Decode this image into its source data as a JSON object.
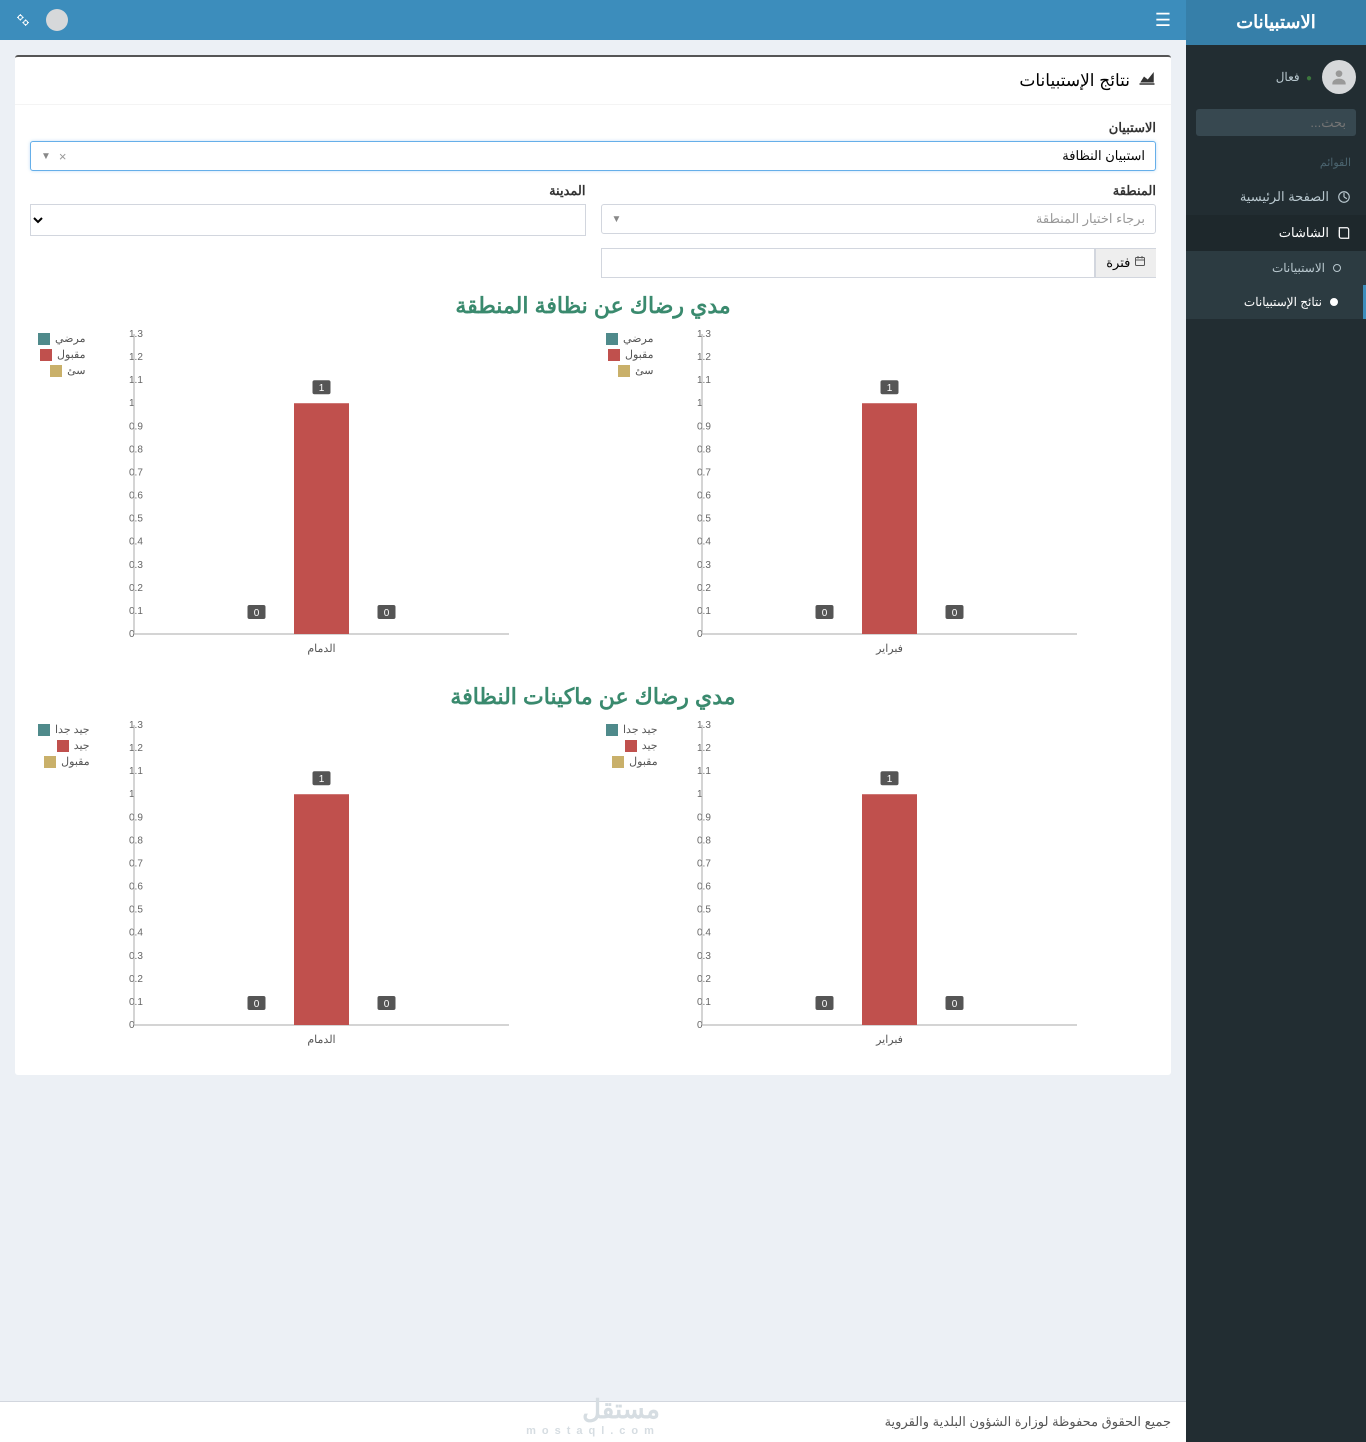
{
  "brand": "الاستبيانات",
  "user": {
    "status": "فعال"
  },
  "search": {
    "placeholder": "بحث..."
  },
  "sidebar": {
    "menus_header": "القوائم",
    "home": "الصفحة الرئيسية",
    "screens": "الشاشات",
    "sub": {
      "surveys": "الاستبيانات",
      "results": "نتائج الإستبيانات"
    }
  },
  "panel": {
    "title": "نتائج الإستبيانات"
  },
  "form": {
    "survey_label": "الاستبيان",
    "survey_value": "استبيان النظافة",
    "region_label": "المنطقة",
    "region_placeholder": "برجاء اختيار المنطقة",
    "city_label": "المدينة",
    "date_label": "فترة"
  },
  "section1_title": "مدي رضاك عن نظافة المنطقة",
  "section2_title": "مدي رضاك عن ماكينات النظافة",
  "legend1": {
    "a": "مرضي",
    "b": "مقبول",
    "c": "سئ"
  },
  "legend2": {
    "a": "جيد جدا",
    "b": "جيد",
    "c": "مقبول"
  },
  "colors": {
    "a": "#4f8a8b",
    "b": "#c0504d",
    "c": "#c9b06a"
  },
  "footer": "جميع الحقوق محفوظة لوزارة الشؤون البلدية والقروية",
  "watermark": {
    "main": "مستقل",
    "sub": "mostaql.com"
  },
  "chart_data": [
    {
      "type": "bar",
      "title": "مدي رضاك عن نظافة المنطقة",
      "categories": [
        "فبراير"
      ],
      "series": [
        {
          "name": "مرضي",
          "values": [
            0
          ]
        },
        {
          "name": "مقبول",
          "values": [
            1
          ]
        },
        {
          "name": "سئ",
          "values": [
            0
          ]
        }
      ],
      "ylim": [
        0,
        1.3
      ],
      "yticks": [
        0,
        0.1,
        0.2,
        0.3,
        0.4,
        0.5,
        0.6,
        0.7,
        0.8,
        0.9,
        1,
        1.1,
        1.2,
        1.3
      ]
    },
    {
      "type": "bar",
      "title": "مدي رضاك عن نظافة المنطقة",
      "categories": [
        "الدمام"
      ],
      "series": [
        {
          "name": "مرضي",
          "values": [
            0
          ]
        },
        {
          "name": "مقبول",
          "values": [
            1
          ]
        },
        {
          "name": "سئ",
          "values": [
            0
          ]
        }
      ],
      "ylim": [
        0,
        1.3
      ],
      "yticks": [
        0,
        0.1,
        0.2,
        0.3,
        0.4,
        0.5,
        0.6,
        0.7,
        0.8,
        0.9,
        1,
        1.1,
        1.2,
        1.3
      ]
    },
    {
      "type": "bar",
      "title": "مدي رضاك عن ماكينات النظافة",
      "categories": [
        "فبراير"
      ],
      "series": [
        {
          "name": "جيد جدا",
          "values": [
            0
          ]
        },
        {
          "name": "جيد",
          "values": [
            1
          ]
        },
        {
          "name": "مقبول",
          "values": [
            0
          ]
        }
      ],
      "ylim": [
        0,
        1.3
      ],
      "yticks": [
        0,
        0.1,
        0.2,
        0.3,
        0.4,
        0.5,
        0.6,
        0.7,
        0.8,
        0.9,
        1,
        1.1,
        1.2,
        1.3
      ]
    },
    {
      "type": "bar",
      "title": "مدي رضاك عن ماكينات النظافة",
      "categories": [
        "الدمام"
      ],
      "series": [
        {
          "name": "جيد جدا",
          "values": [
            0
          ]
        },
        {
          "name": "جيد",
          "values": [
            1
          ]
        },
        {
          "name": "مقبول",
          "values": [
            0
          ]
        }
      ],
      "ylim": [
        0,
        1.3
      ],
      "yticks": [
        0,
        0.1,
        0.2,
        0.3,
        0.4,
        0.5,
        0.6,
        0.7,
        0.8,
        0.9,
        1,
        1.1,
        1.2,
        1.3
      ]
    }
  ]
}
